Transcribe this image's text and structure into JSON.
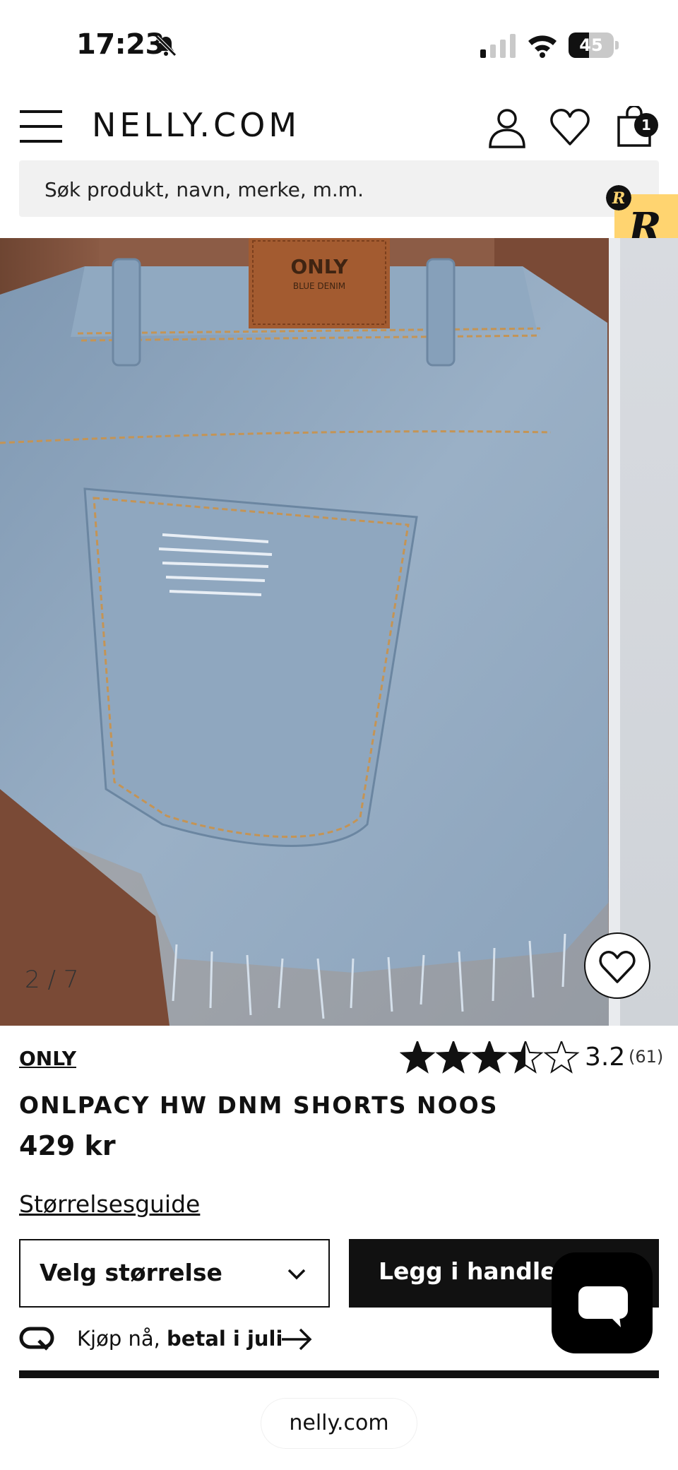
{
  "status_bar": {
    "time": "17:23",
    "battery": "45",
    "battery_level": 0.45
  },
  "header": {
    "logo": "NELLY.COM",
    "cart_count": "1"
  },
  "search": {
    "placeholder": "Søk produkt, navn, merke, m.m."
  },
  "gallery": {
    "counter": "2 / 7",
    "label_brand": "ONLY",
    "label_sub": "BLUE DENIM"
  },
  "product": {
    "brand": "ONLY",
    "rating_value": "3.2",
    "rating_count": "(61)",
    "rating_stars": 3.5,
    "name": "ONLPACY HW DNM SHORTS NOOS",
    "price": "429 kr",
    "size_guide": "Størrelsesguide",
    "size_select": "Velg størrelse",
    "add_to_cart": "Legg i handleku"
  },
  "klarna": {
    "text_prefix": "Kjøp nå, ",
    "text_bold": "betal i juli"
  },
  "browser": {
    "url": "nelly.com"
  },
  "colors": {
    "accent": "#111111",
    "rewards": "#ffd470",
    "denim": "#8fa6be"
  }
}
